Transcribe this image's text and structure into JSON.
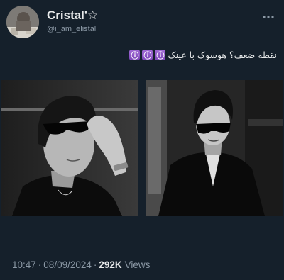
{
  "author": {
    "display_name": "Cristal'☆",
    "handle": "@i_am_elistal",
    "avatar_icon": "profile-photo"
  },
  "header": {
    "more_icon": "more-dots-icon"
  },
  "tweet": {
    "text": "نقطه ضعف؟ هوسوک با عینک",
    "emoji": [
      "ⓘ",
      "ⓘ",
      "ⓘ"
    ],
    "emoji_name": "information-emoji"
  },
  "media": {
    "count": 2,
    "items": [
      {
        "icon": "photo-man-sunglasses-hand"
      },
      {
        "icon": "photo-man-sunglasses-black-suit"
      }
    ]
  },
  "meta": {
    "time": "10:47",
    "separator": "·",
    "date": "08/09/2024",
    "views_count": "292K",
    "views_label": "Views"
  },
  "colors": {
    "background": "#15202b",
    "text_primary": "#e7e9ea",
    "text_secondary": "#8b98a5",
    "emoji_purple": "#8e56c6"
  }
}
